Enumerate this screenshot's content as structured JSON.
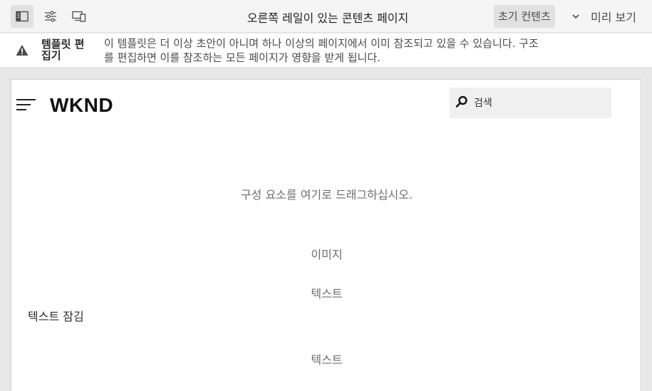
{
  "toolbar": {
    "panel_icon": "side-panel-icon",
    "properties_icon": "sliders-icon",
    "emulator_icon": "device-emulator-icon",
    "page_title": "오른쪽 레일이 있는 콘텐츠 페이지",
    "mode_label": "초기 컨텐츠",
    "mode_chevron": "chevron-down-icon",
    "preview_label": "미리 보기"
  },
  "warning": {
    "icon": "alert-icon",
    "label": "템플릿 편집기",
    "message": "이 템플릿은 더 이상 초안이 아니며 하나 이상의 페이지에서 이미 참조되고 있을 수 있습니다. 구조를 편집하면 이를 참조하는 모든 페이지가 영향을 받게 됩니다."
  },
  "canvas": {
    "menu_icon": "hamburger-menu-icon",
    "logo": "WKND",
    "search_placeholder": "검색",
    "search_icon": "search-icon",
    "drop_hint": "구성 요소를 여기로 드래그하십시오.",
    "components": [
      "이미지",
      "텍스트",
      "텍스트"
    ],
    "locked_label": "텍스트 잠김"
  }
}
